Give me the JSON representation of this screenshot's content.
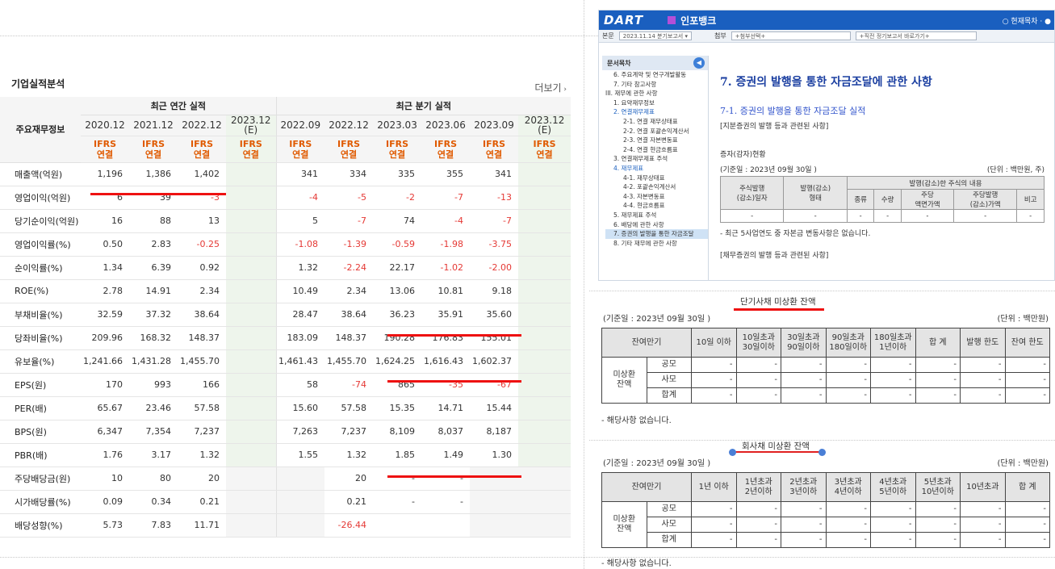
{
  "left_panel": {
    "title": "기업실적분석",
    "more": "더보기",
    "corner": "주요재무정보",
    "group_annual": "최근 연간 실적",
    "group_quarter": "최근 분기 실적",
    "years": [
      "2020.12",
      "2021.12",
      "2022.12",
      "2023.12\n(E)",
      "2022.09",
      "2022.12",
      "2023.03",
      "2023.06",
      "2023.09",
      "2023.12\n(E)"
    ],
    "standard": "IFRS\n연결",
    "rows": [
      {
        "label": "매출액(억원)",
        "vals": [
          "1,196",
          "1,386",
          "1,402",
          "",
          "341",
          "334",
          "335",
          "355",
          "341",
          ""
        ]
      },
      {
        "label": "영업이익(억원)",
        "vals": [
          "6",
          "39",
          "-3",
          "",
          "-4",
          "-5",
          "-2",
          "-7",
          "-13",
          ""
        ]
      },
      {
        "label": "당기순이익(억원)",
        "vals": [
          "16",
          "88",
          "13",
          "",
          "5",
          "-7",
          "74",
          "-4",
          "-7",
          ""
        ]
      },
      {
        "label": "영업이익률(%)",
        "vals": [
          "0.50",
          "2.83",
          "-0.25",
          "",
          "-1.08",
          "-1.39",
          "-0.59",
          "-1.98",
          "-3.75",
          ""
        ]
      },
      {
        "label": "순이익률(%)",
        "vals": [
          "1.34",
          "6.39",
          "0.92",
          "",
          "1.32",
          "-2.24",
          "22.17",
          "-1.02",
          "-2.00",
          ""
        ]
      },
      {
        "label": "ROE(%)",
        "vals": [
          "2.78",
          "14.91",
          "2.34",
          "",
          "10.49",
          "2.34",
          "13.06",
          "10.81",
          "9.18",
          ""
        ]
      },
      {
        "label": "부채비율(%)",
        "vals": [
          "32.59",
          "37.32",
          "38.64",
          "",
          "28.47",
          "38.64",
          "36.23",
          "35.91",
          "35.60",
          ""
        ]
      },
      {
        "label": "당좌비율(%)",
        "vals": [
          "209.96",
          "168.32",
          "148.37",
          "",
          "183.09",
          "148.37",
          "190.28",
          "176.83",
          "155.01",
          ""
        ]
      },
      {
        "label": "유보율(%)",
        "vals": [
          "1,241.66",
          "1,431.28",
          "1,455.70",
          "",
          "1,461.43",
          "1,455.70",
          "1,624.25",
          "1,616.43",
          "1,602.37",
          ""
        ]
      },
      {
        "label": "EPS(원)",
        "vals": [
          "170",
          "993",
          "166",
          "",
          "58",
          "-74",
          "865",
          "-35",
          "-67",
          ""
        ]
      },
      {
        "label": "PER(배)",
        "vals": [
          "65.67",
          "23.46",
          "57.58",
          "",
          "15.60",
          "57.58",
          "15.35",
          "14.71",
          "15.44",
          ""
        ]
      },
      {
        "label": "BPS(원)",
        "vals": [
          "6,347",
          "7,354",
          "7,237",
          "",
          "7,263",
          "7,237",
          "8,109",
          "8,037",
          "8,187",
          ""
        ]
      },
      {
        "label": "PBR(배)",
        "vals": [
          "1.76",
          "3.17",
          "1.32",
          "",
          "1.55",
          "1.32",
          "1.85",
          "1.49",
          "1.30",
          ""
        ]
      },
      {
        "label": "주당배당금(원)",
        "vals": [
          "10",
          "80",
          "20",
          "",
          "",
          "20",
          "-",
          "-",
          "",
          ""
        ]
      },
      {
        "label": "시가배당률(%)",
        "vals": [
          "0.09",
          "0.34",
          "0.21",
          "",
          "",
          "0.21",
          "-",
          "-",
          "",
          ""
        ]
      },
      {
        "label": "배당성향(%)",
        "vals": [
          "5.73",
          "7.83",
          "11.71",
          "",
          "",
          "-26.44",
          "",
          "",
          "",
          ""
        ]
      }
    ]
  },
  "dart": {
    "logo": "DART",
    "app_title": "인포뱅크",
    "header_right": "○ 현재목차 · ●",
    "bar": {
      "label1": "본문",
      "sel1": "2023.11.14 분기보고서",
      "label2": "첨부",
      "sel2": "+첨부선택+",
      "sel3": "+직전 정기보고서 바로가기+"
    },
    "sidebar_title": "문서목차",
    "toc": [
      "6. 주요계약 및 연구개발활동",
      "7. 기타 참고사항",
      "III. 재무에 관한 사항",
      "1. 요약재무정보",
      "2. 연결재무제표",
      "2-1. 연결 재무상태표",
      "2-2. 연결 포괄손익계산서",
      "2-3. 연결 자본변동표",
      "2-4. 연결 현금흐름표",
      "3. 연결재무제표 주석",
      "4. 재무제표",
      "4-1. 재무상태표",
      "4-2. 포괄손익계산서",
      "4-3. 자본변동표",
      "4-4. 현금흐름표",
      "5. 재무제표 주석",
      "6. 배당에 관한 사항",
      "7. 증권의 발행을 통한 자금조달",
      "8. 기타 재무에 관한 사항"
    ],
    "heading": "7. 증권의 발행을 통한 자금조달에 관한 사항",
    "subheading": "7-1. 증권의 발행을 통한 자금조달 실적",
    "note1": "[지분증권의 발행 등과 관련된 사항]",
    "caption": "증자(감자)현황",
    "base_date": "(기준일 :        2023년 09월 30일      )",
    "unit": "(단위 : 백만원, 주)",
    "table_head": [
      "주식발행\n(감소)일자",
      "발행(감소)\n형태",
      "발행(감소)한 주식의 내용",
      "종류",
      "수량",
      "주당\n액면가액",
      "주당발행\n(감소)가액",
      "비고"
    ],
    "table_row": [
      "-",
      "-",
      "-",
      "-",
      "-",
      "-",
      "-"
    ],
    "note2": "- 최근 5사업연도 중 자본금 변동사항은 없습니다.",
    "note3": "[채무증권의 발행 등과 관련된 사항]"
  },
  "short_term": {
    "title": "단기사채 미상환 잔액",
    "base_date": "(기준일 :        2023년 09월 30일      )",
    "unit": "(단위 : 백만원)",
    "headers": [
      "잔여만기",
      "10일 이하",
      "10일초과\n30일이하",
      "30일초과\n90일이하",
      "90일초과\n180일이하",
      "180일초과\n1년이하",
      "합 계",
      "발행 한도",
      "잔여 한도"
    ],
    "row_group": "미상환\n잔액",
    "rows": [
      {
        "label": "공모",
        "vals": [
          "-",
          "-",
          "-",
          "-",
          "-",
          "-",
          "-",
          "-"
        ]
      },
      {
        "label": "사모",
        "vals": [
          "-",
          "-",
          "-",
          "-",
          "-",
          "-",
          "-",
          "-"
        ]
      },
      {
        "label": "합계",
        "vals": [
          "-",
          "-",
          "-",
          "-",
          "-",
          "-",
          "-",
          "-"
        ]
      }
    ],
    "note": "- 해당사항 없습니다."
  },
  "corp_bond": {
    "title": "회사채 미상환 잔액",
    "base_date": "(기준일 :        2023년 09월 30일      )",
    "unit": "(단위 : 백만원)",
    "headers": [
      "잔여만기",
      "1년 이하",
      "1년초과\n2년이하",
      "2년초과\n3년이하",
      "3년초과\n4년이하",
      "4년초과\n5년이하",
      "5년초과\n10년이하",
      "10년초과",
      "합 계"
    ],
    "row_group": "미상환\n잔액",
    "rows": [
      {
        "label": "공모",
        "vals": [
          "-",
          "-",
          "-",
          "-",
          "-",
          "-",
          "-",
          "-"
        ]
      },
      {
        "label": "사모",
        "vals": [
          "-",
          "-",
          "-",
          "-",
          "-",
          "-",
          "-",
          "-"
        ]
      },
      {
        "label": "합계",
        "vals": [
          "-",
          "-",
          "-",
          "-",
          "-",
          "-",
          "-",
          "-"
        ]
      }
    ],
    "note": "- 해당사항 없습니다."
  },
  "colors": {
    "negative": "#e53935",
    "ifrs": "#e05a00",
    "estimate_bg": "#eef5ec",
    "annotation": "#ee1111",
    "dart_blue": "#1a5fbf"
  }
}
